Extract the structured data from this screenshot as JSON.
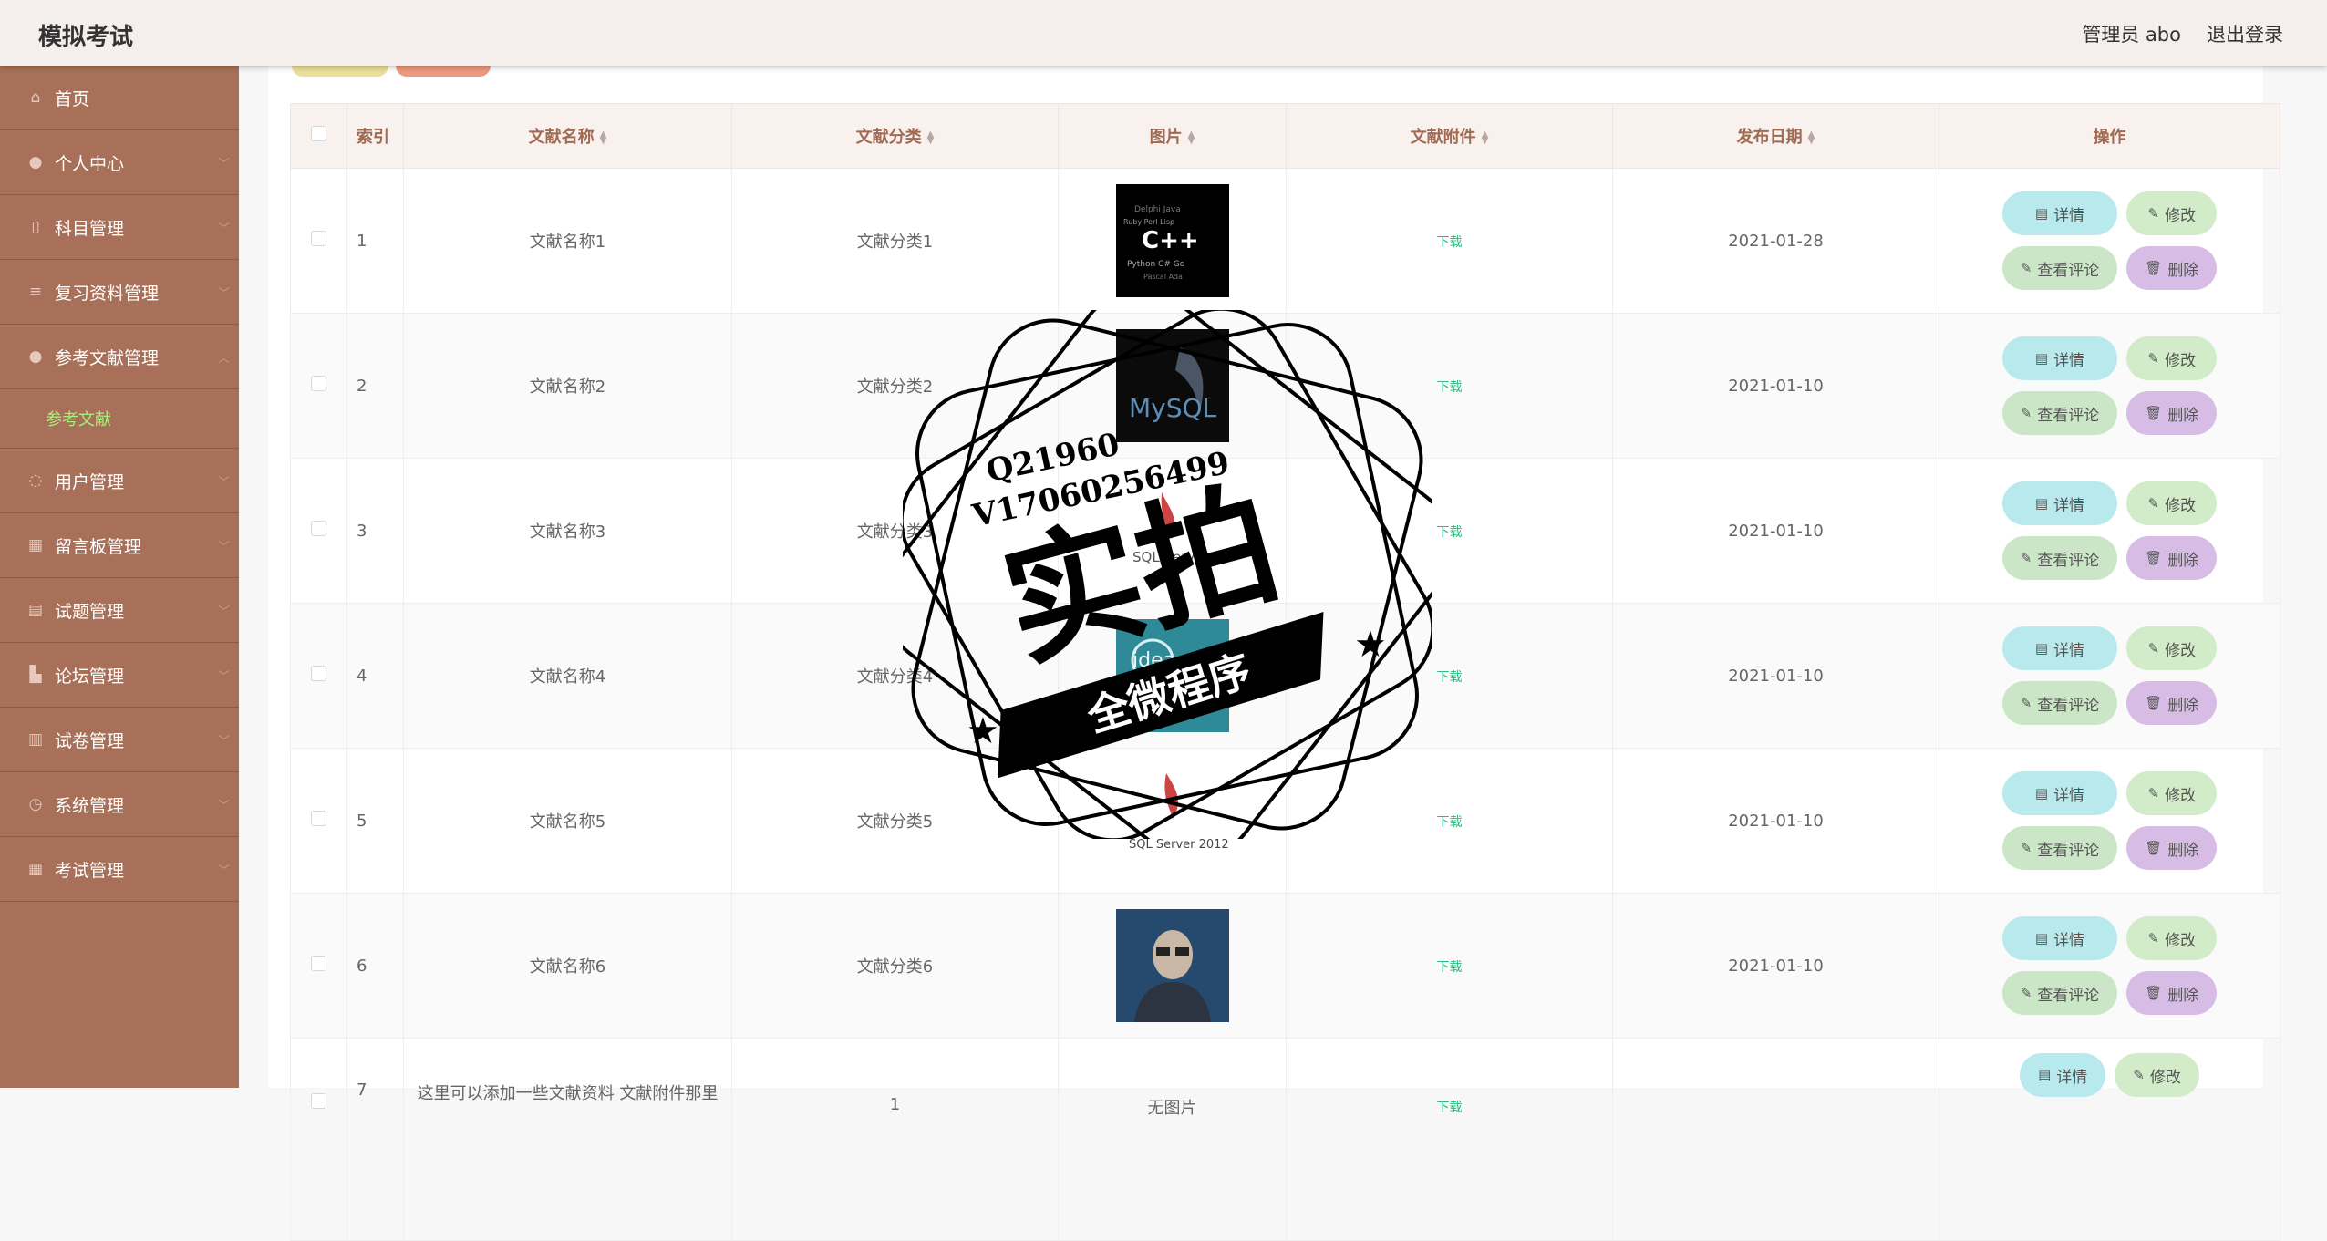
{
  "header": {
    "title": "模拟考试",
    "admin": "管理员 abo",
    "logout": "退出登录"
  },
  "sidebar": {
    "items": [
      {
        "label": "首页",
        "icon": "home-icon",
        "glyph": "⌂"
      },
      {
        "label": "个人中心",
        "icon": "user-icon",
        "glyph": "●"
      },
      {
        "label": "科目管理",
        "icon": "mic-icon",
        "glyph": "▯"
      },
      {
        "label": "复习资料管理",
        "icon": "list-icon",
        "glyph": "≡"
      },
      {
        "label": "参考文献管理",
        "icon": "location-icon",
        "glyph": "●",
        "active": true
      },
      {
        "label": "用户管理",
        "icon": "circle-icon",
        "glyph": "◌"
      },
      {
        "label": "留言板管理",
        "icon": "grid-icon",
        "glyph": "▦"
      },
      {
        "label": "试题管理",
        "icon": "document-icon",
        "glyph": "▤"
      },
      {
        "label": "论坛管理",
        "icon": "thumb-icon",
        "glyph": "▙"
      },
      {
        "label": "试卷管理",
        "icon": "chart-icon",
        "glyph": "▥"
      },
      {
        "label": "系统管理",
        "icon": "clock-icon",
        "glyph": "◷"
      },
      {
        "label": "考试管理",
        "icon": "apps-icon",
        "glyph": "▦"
      }
    ],
    "submenu": {
      "label": "参考文献"
    }
  },
  "table": {
    "headers": {
      "index": "索引",
      "name": "文献名称",
      "category": "文献分类",
      "image": "图片",
      "attachment": "文献附件",
      "date": "发布日期",
      "actions": "操作"
    },
    "rows": [
      {
        "index": "1",
        "name": "文献名称1",
        "category": "文献分类1",
        "image": "cpp-wordcloud-image",
        "attachment": "下载",
        "date": "2021-01-28"
      },
      {
        "index": "2",
        "name": "文献名称2",
        "category": "文献分类2",
        "image": "mysql-logo-image",
        "attachment": "下载",
        "date": "2021-01-10"
      },
      {
        "index": "3",
        "name": "文献名称3",
        "category": "文献分类3",
        "image": "sqlserver-logo-image",
        "attachment": "下载",
        "date": "2021-01-10"
      },
      {
        "index": "4",
        "name": "文献名称4",
        "category": "文献分类4",
        "image": "idea-logo-image",
        "attachment": "下载",
        "date": "2021-01-10"
      },
      {
        "index": "5",
        "name": "文献名称5",
        "category": "文献分类5",
        "image": "sqlserver2012-logo-image",
        "attachment": "下载",
        "date": "2021-01-10"
      },
      {
        "index": "6",
        "name": "文献名称6",
        "category": "文献分类6",
        "image": "programmer-photo-image",
        "attachment": "下载",
        "date": "2021-01-10"
      },
      {
        "index": "7",
        "name": "这里可以添加一些文献资料 文献附件那里",
        "category": "1",
        "image": "",
        "image_text": "无图片",
        "attachment": "下载",
        "date": ""
      }
    ]
  },
  "actions": {
    "detail": "详情",
    "edit": "修改",
    "comment": "查看评论",
    "delete": "删除"
  },
  "overlay": {
    "qq": "Q21960",
    "wechat": "V17060256499",
    "big": "实拍",
    "band": "全微程序",
    "thumb_texts": {
      "cpp": "C++",
      "mysql": "MySQL",
      "sqlserver": "SQL Server",
      "sqlserver2012": "SQL Server 2012",
      "idea": "idea"
    }
  },
  "colors": {
    "sidebar": "#a87058",
    "submenu_active": "#a8f07a",
    "header_bg": "#f4eeec",
    "download": "#2db87d",
    "btn_detail": "#b8e9ec",
    "btn_edit": "#d2ecc9",
    "btn_delete": "#d7bde5"
  }
}
